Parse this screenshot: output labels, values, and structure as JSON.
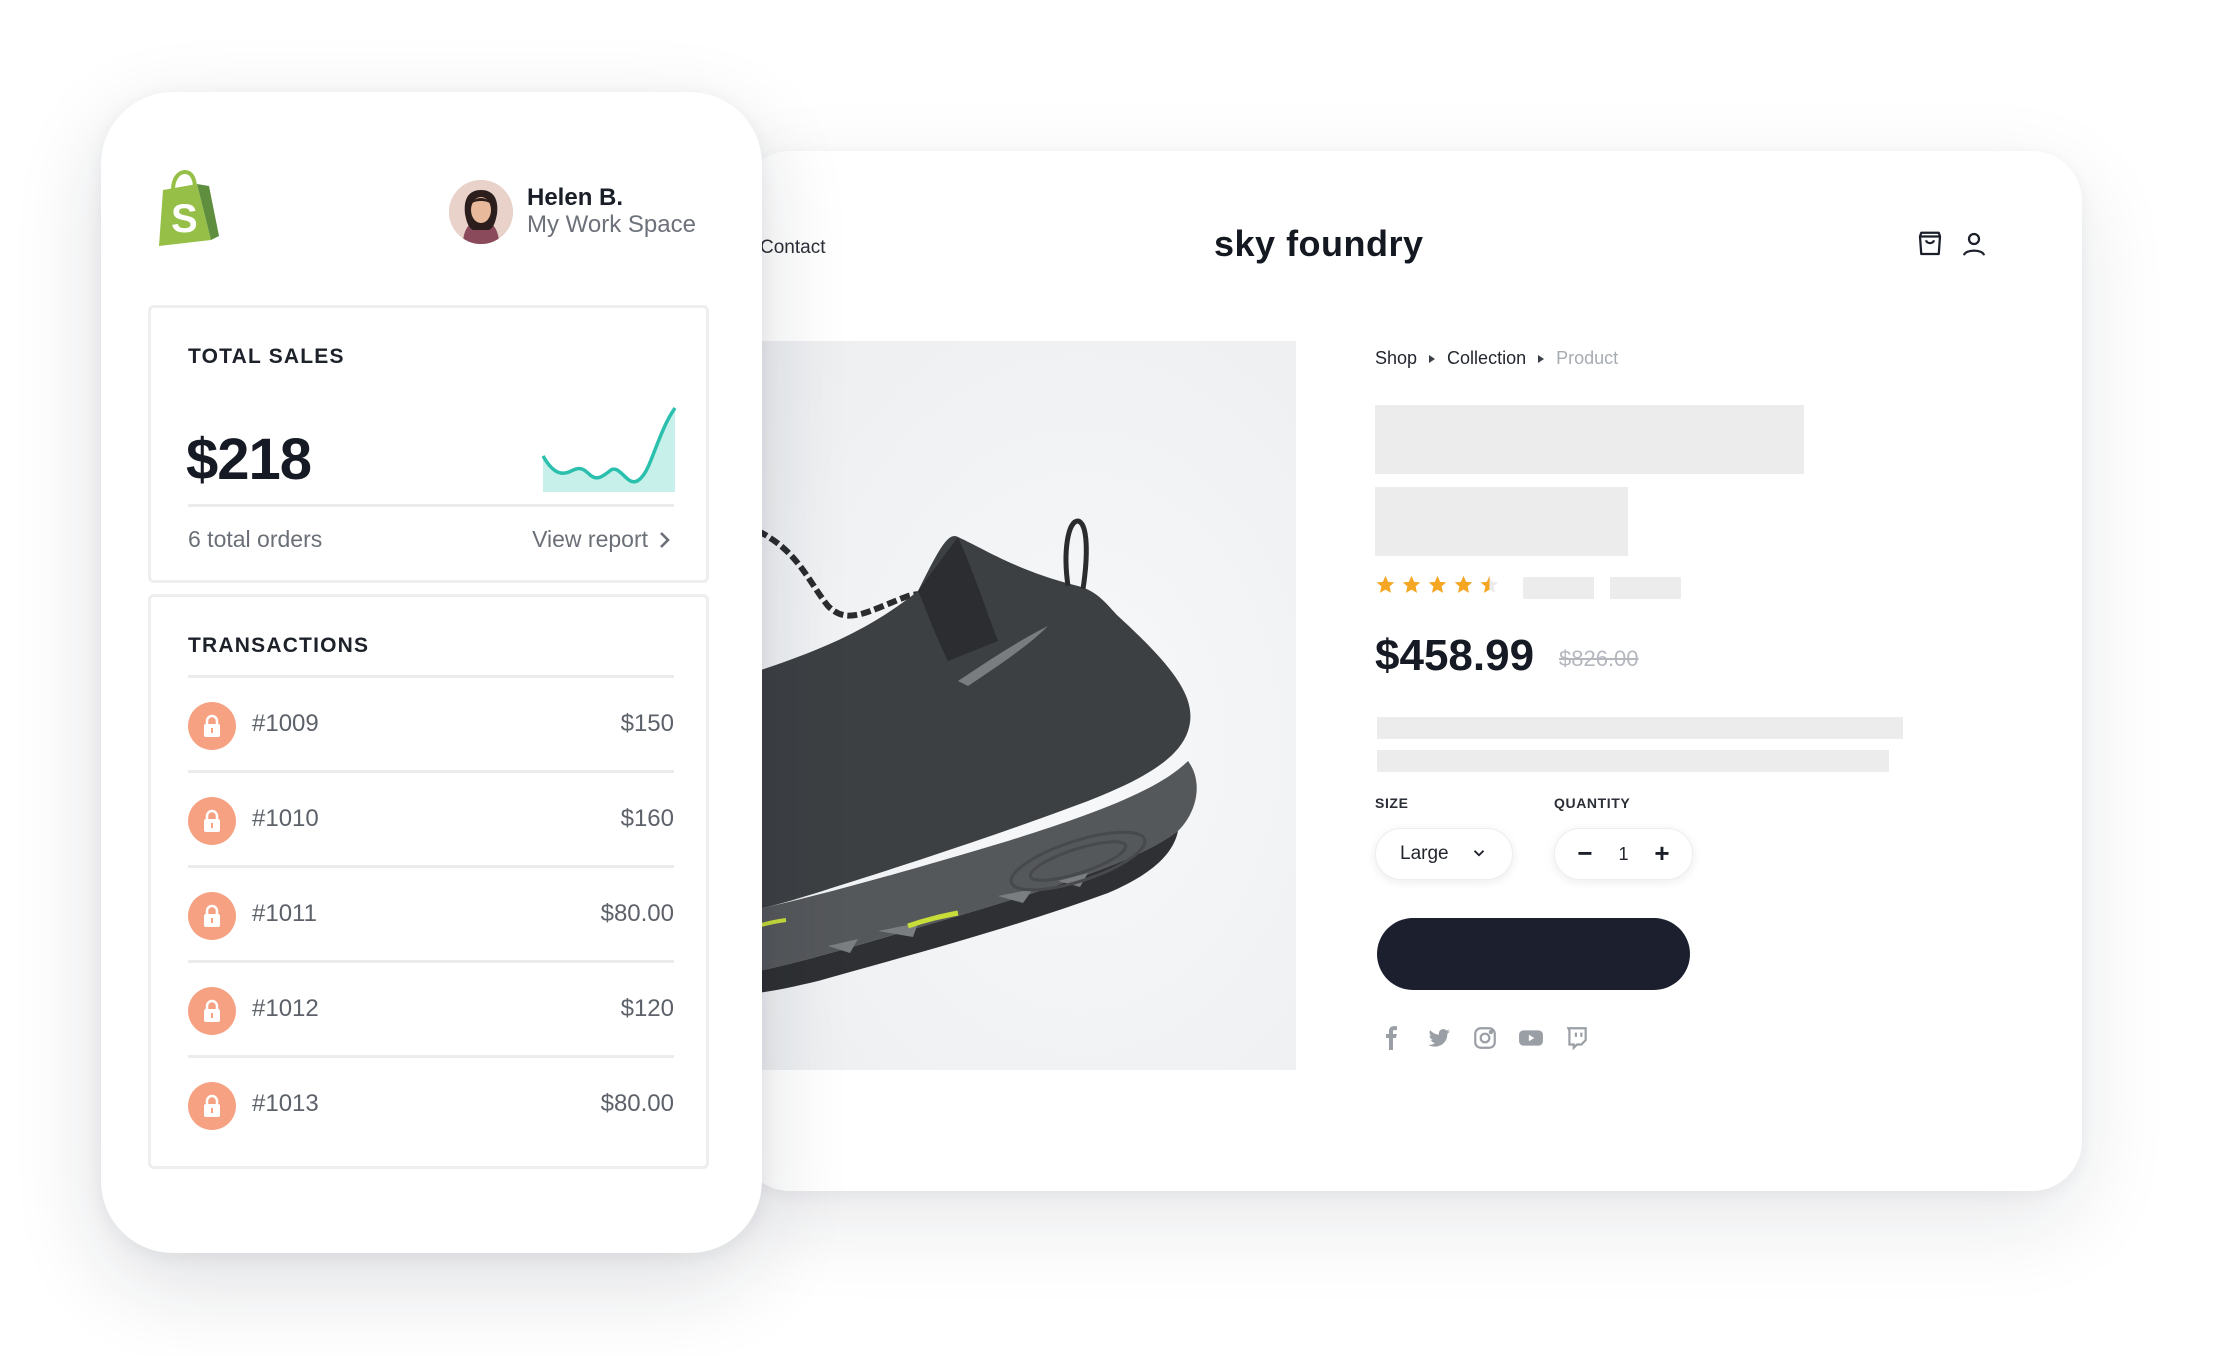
{
  "storefront": {
    "nav_link": "Contact",
    "brand": "sky foundry",
    "breadcrumb": [
      "Shop",
      "Collection",
      "Product"
    ],
    "rating_stars": 4.5,
    "price": "$458.99",
    "compare_price": "$826.00",
    "size_label": "SIZE",
    "size_value": "Large",
    "quantity_label": "QUANTITY",
    "quantity_value": "1",
    "icons": [
      "cart-icon",
      "account-icon",
      "facebook-icon",
      "twitter-icon",
      "instagram-icon",
      "youtube-icon",
      "twitch-icon"
    ],
    "colors": {
      "star": "#f5a623",
      "cta": "#1b1f2e"
    }
  },
  "admin": {
    "user_name": "Helen B.",
    "workspace": "My Work Space",
    "total_sales": {
      "title": "TOTAL SALES",
      "value": "$218",
      "orders": "6 total orders",
      "view_report": "View report"
    },
    "transactions": {
      "title": "TRANSACTIONS",
      "items": [
        {
          "id": "#1009",
          "amount": "$150"
        },
        {
          "id": "#1010",
          "amount": "$160"
        },
        {
          "id": "#1011",
          "amount": "$80.00"
        },
        {
          "id": "#1012",
          "amount": "$120"
        },
        {
          "id": "#1013",
          "amount": "$80.00"
        }
      ]
    },
    "colors": {
      "brand_green": "#95bf47",
      "sparkline": "#2bbfae",
      "tx_icon": "#f6a182"
    }
  }
}
